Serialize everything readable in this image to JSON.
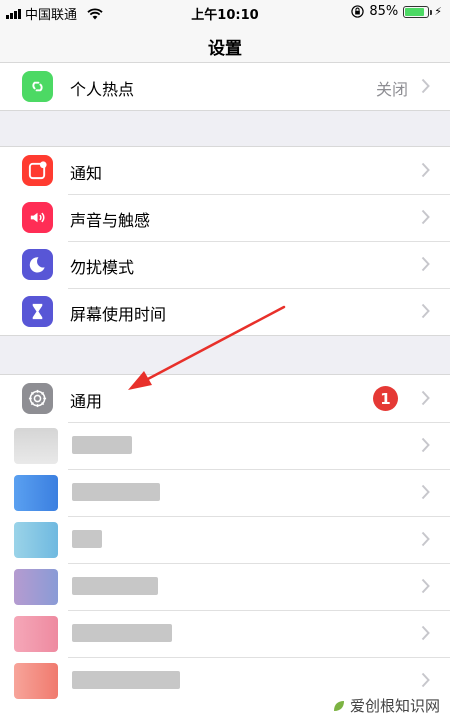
{
  "status_bar": {
    "carrier": "中国联通",
    "time": "上午10:10",
    "battery_percent": "85%",
    "battery_level": 0.85
  },
  "nav": {
    "title": "设置"
  },
  "group_hotspot": {
    "items": [
      {
        "label": "个人热点",
        "value": "关闭",
        "icon": "hotspot-icon",
        "color": "#4cd964"
      }
    ]
  },
  "group_notifications": {
    "items": [
      {
        "label": "通知",
        "icon": "notification-icon",
        "color": "#ff3b30"
      },
      {
        "label": "声音与触感",
        "icon": "speaker-icon",
        "color": "#ff2d55"
      },
      {
        "label": "勿扰模式",
        "icon": "moon-icon",
        "color": "#5856d6"
      },
      {
        "label": "屏幕使用时间",
        "icon": "hourglass-icon",
        "color": "#5856d6"
      }
    ]
  },
  "group_general": {
    "items": [
      {
        "label": "通用",
        "badge": "1",
        "icon": "gear-icon",
        "color": "#8e8e93"
      }
    ]
  },
  "watermark": {
    "text": "爱创根知识网"
  }
}
